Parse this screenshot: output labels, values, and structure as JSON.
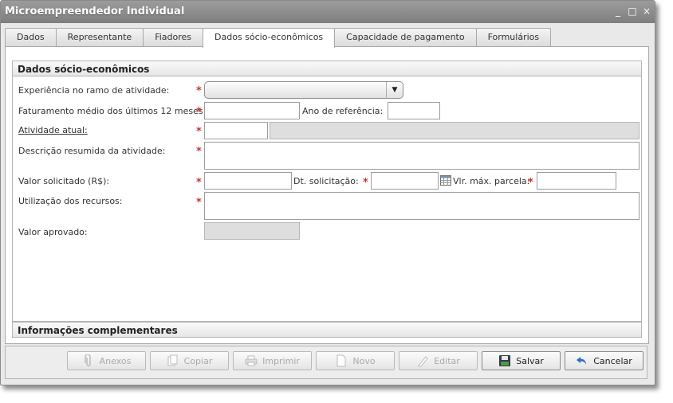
{
  "window": {
    "title": "Microempreendedor Individual",
    "controls": [
      "_",
      "□",
      "×"
    ]
  },
  "tabs": [
    {
      "label": "Dados",
      "active": false
    },
    {
      "label": "Representante",
      "active": false
    },
    {
      "label": "Fiadores",
      "active": false
    },
    {
      "label": "Dados sócio-econômicos",
      "active": true
    },
    {
      "label": "Capacidade de pagamento",
      "active": false
    },
    {
      "label": "Formulários",
      "active": false
    }
  ],
  "section": {
    "title": "Dados sócio-econômicos",
    "fields": {
      "experiencia": {
        "label": "Experiência no ramo de atividade:",
        "value": ""
      },
      "faturamento": {
        "label": "Faturamento médio dos últimos 12 meses:",
        "value": ""
      },
      "ano_referencia": {
        "label": "Ano de referência:",
        "value": ""
      },
      "atividade_atual": {
        "label": "Atividade atual:",
        "code": "",
        "description": ""
      },
      "descricao": {
        "label": "Descrição resumida da atividade:",
        "value": ""
      },
      "valor_solicitado": {
        "label": "Valor solicitado (R$):",
        "value": ""
      },
      "dt_solicitacao": {
        "label": "Dt. solicitação:",
        "value": ""
      },
      "vlr_max_parcela": {
        "label": "Vlr. máx. parcela:",
        "value": ""
      },
      "utilizacao": {
        "label": "Utilização dos recursos:",
        "value": ""
      },
      "valor_aprovado": {
        "label": "Valor aprovado:",
        "value": ""
      }
    },
    "required_marker": "*"
  },
  "section2": {
    "title": "Informações complementares"
  },
  "buttons": [
    {
      "label": "Anexos",
      "icon": "clip-icon",
      "enabled": false
    },
    {
      "label": "Copiar",
      "icon": "copy-icon",
      "enabled": false
    },
    {
      "label": "Imprimir",
      "icon": "printer-icon",
      "enabled": false
    },
    {
      "label": "Novo",
      "icon": "new-document-icon",
      "enabled": false
    },
    {
      "label": "Editar",
      "icon": "pencil-icon",
      "enabled": false
    },
    {
      "label": "Salvar",
      "icon": "save-icon",
      "enabled": true
    },
    {
      "label": "Cancelar",
      "icon": "undo-icon",
      "enabled": true
    }
  ],
  "colors": {
    "required": "#c0392b",
    "titlebar": "#8d8d8d",
    "panel": "#ffffff"
  }
}
